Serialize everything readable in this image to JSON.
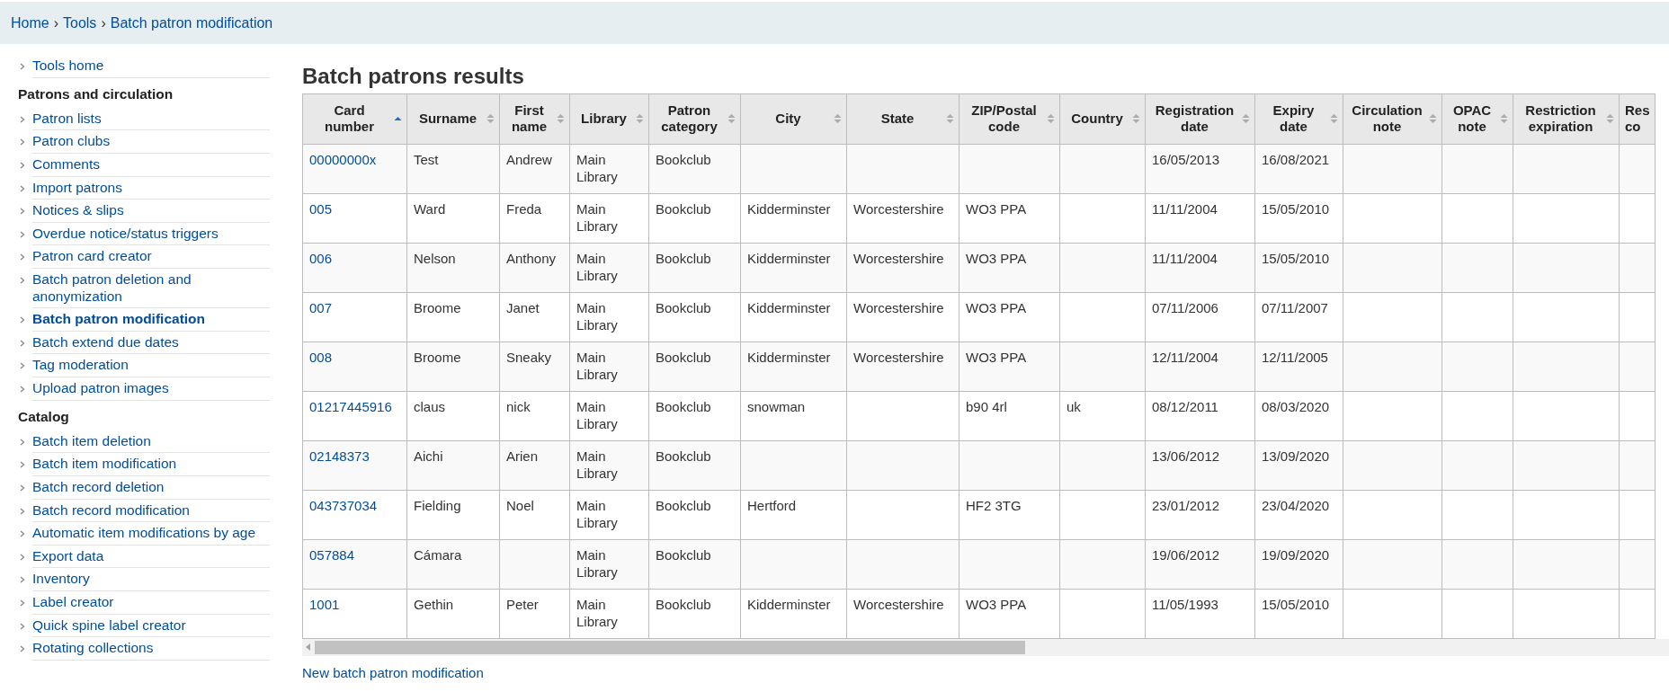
{
  "breadcrumbs": [
    {
      "label": "Home",
      "separator": "›"
    },
    {
      "label": "Tools",
      "separator": "›"
    },
    {
      "label": "Batch patron modification"
    }
  ],
  "sidebar": {
    "groups": [
      {
        "items": [
          {
            "label": "Tools home",
            "selected": false
          }
        ]
      },
      {
        "heading": "Patrons and circulation",
        "items": [
          {
            "label": "Patron lists",
            "selected": false
          },
          {
            "label": "Patron clubs",
            "selected": false
          },
          {
            "label": "Comments",
            "selected": false
          },
          {
            "label": "Import patrons",
            "selected": false
          },
          {
            "label": "Notices & slips",
            "selected": false
          },
          {
            "label": "Overdue notice/status triggers",
            "selected": false
          },
          {
            "label": "Patron card creator",
            "selected": false
          },
          {
            "label": "Batch patron deletion and anonymization",
            "selected": false
          },
          {
            "label": "Batch patron modification",
            "selected": true
          },
          {
            "label": "Batch extend due dates",
            "selected": false
          },
          {
            "label": "Tag moderation",
            "selected": false
          },
          {
            "label": "Upload patron images",
            "selected": false
          }
        ]
      },
      {
        "heading": "Catalog",
        "items": [
          {
            "label": "Batch item deletion",
            "selected": false
          },
          {
            "label": "Batch item modification",
            "selected": false
          },
          {
            "label": "Batch record deletion",
            "selected": false
          },
          {
            "label": "Batch record modification",
            "selected": false
          },
          {
            "label": "Automatic item modifications by age",
            "selected": false
          },
          {
            "label": "Export data",
            "selected": false
          },
          {
            "label": "Inventory",
            "selected": false
          },
          {
            "label": "Label creator",
            "selected": false
          },
          {
            "label": "Quick spine label creator",
            "selected": false
          },
          {
            "label": "Rotating collections",
            "selected": false
          }
        ]
      }
    ]
  },
  "title": "Batch patrons results",
  "table": {
    "columns": [
      {
        "label": "Card number",
        "sorted": true
      },
      {
        "label": "Surname",
        "sorted": false
      },
      {
        "label": "First name",
        "sorted": false
      },
      {
        "label": "Library",
        "sorted": false
      },
      {
        "label": "Patron category",
        "sorted": false
      },
      {
        "label": "City",
        "sorted": false
      },
      {
        "label": "State",
        "sorted": false
      },
      {
        "label": "ZIP/Postal code",
        "sorted": false
      },
      {
        "label": "Country",
        "sorted": false
      },
      {
        "label": "Registration date",
        "sorted": false
      },
      {
        "label": "Expiry date",
        "sorted": false
      },
      {
        "label": "Circulation note",
        "sorted": false
      },
      {
        "label": "OPAC note",
        "sorted": false
      },
      {
        "label": "Restriction expiration",
        "sorted": false
      },
      {
        "label": "Res co"
      }
    ],
    "rows": [
      [
        "00000000x",
        "Test",
        "Andrew",
        "Main Library",
        "Bookclub",
        null,
        null,
        null,
        null,
        "16/05/2013",
        "16/08/2021",
        null,
        null,
        null,
        null
      ],
      [
        "005",
        "Ward",
        "Freda",
        "Main Library",
        "Bookclub",
        "Kidderminster",
        "Worcestershire",
        "WO3 PPA",
        null,
        "11/11/2004",
        "15/05/2010",
        null,
        null,
        null,
        null
      ],
      [
        "006",
        "Nelson",
        "Anthony",
        "Main Library",
        "Bookclub",
        "Kidderminster",
        "Worcestershire",
        "WO3 PPA",
        null,
        "11/11/2004",
        "15/05/2010",
        null,
        null,
        null,
        null
      ],
      [
        "007",
        "Broome",
        "Janet",
        "Main Library",
        "Bookclub",
        "Kidderminster",
        "Worcestershire",
        "WO3 PPA",
        null,
        "07/11/2006",
        "07/11/2007",
        null,
        null,
        null,
        null
      ],
      [
        "008",
        "Broome",
        "Sneaky",
        "Main Library",
        "Bookclub",
        "Kidderminster",
        "Worcestershire",
        "WO3 PPA",
        null,
        "12/11/2004",
        "12/11/2005",
        null,
        null,
        null,
        null
      ],
      [
        "01217445916",
        "claus",
        "nick",
        "Main Library",
        "Bookclub",
        "snowman",
        null,
        "b90 4rl",
        "uk",
        "08/12/2011",
        "08/03/2020",
        null,
        null,
        null,
        null
      ],
      [
        "02148373",
        "Aichi",
        "Arien",
        "Main Library",
        "Bookclub",
        null,
        null,
        null,
        null,
        "13/06/2012",
        "13/09/2020",
        null,
        null,
        null,
        null
      ],
      [
        "043737034",
        "Fielding",
        "Noel",
        "Main Library",
        "Bookclub",
        "Hertford",
        null,
        "HF2 3TG",
        null,
        "23/01/2012",
        "23/04/2020",
        null,
        null,
        null,
        null
      ],
      [
        "057884",
        "Cámara",
        null,
        "Main Library",
        "Bookclub",
        null,
        null,
        null,
        null,
        "19/06/2012",
        "19/09/2020",
        null,
        null,
        null,
        null
      ],
      [
        "1001",
        "Gethin",
        "Peter",
        "Main Library",
        "Bookclub",
        "Kidderminster",
        "Worcestershire",
        "WO3 PPA",
        null,
        "11/05/1993",
        "15/05/2010",
        null,
        null,
        null,
        null
      ]
    ]
  },
  "footer_link": "New batch patron modification"
}
